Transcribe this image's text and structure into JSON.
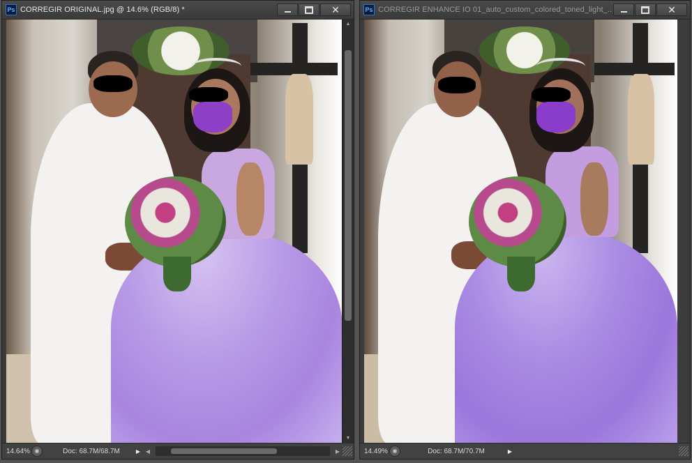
{
  "windows": [
    {
      "id": "left",
      "title": "CORREGIR ORIGINAL.jpg @ 14.6% (RGB/8) *",
      "active": true,
      "zoom": "14.64%",
      "doc": "Doc: 68.7M/68.7M"
    },
    {
      "id": "right",
      "title": "CORREGIR ENHANCE IO 01_auto_custom_colored_toned_light_...",
      "active": false,
      "zoom": "14.49%",
      "doc": "Doc: 68.7M/70.7M"
    }
  ],
  "icons": {
    "app": "Ps",
    "minimize": "minimize-icon",
    "maximize": "maximize-icon",
    "close": "close-icon",
    "close_glyph": "✕",
    "play": "▶",
    "left_arrow": "◀",
    "right_arrow": "▶",
    "up_arrow": "▲",
    "down_arrow": "▼"
  },
  "colors": {
    "gown": "#b79ae6",
    "mask": "#8d3fc8"
  }
}
